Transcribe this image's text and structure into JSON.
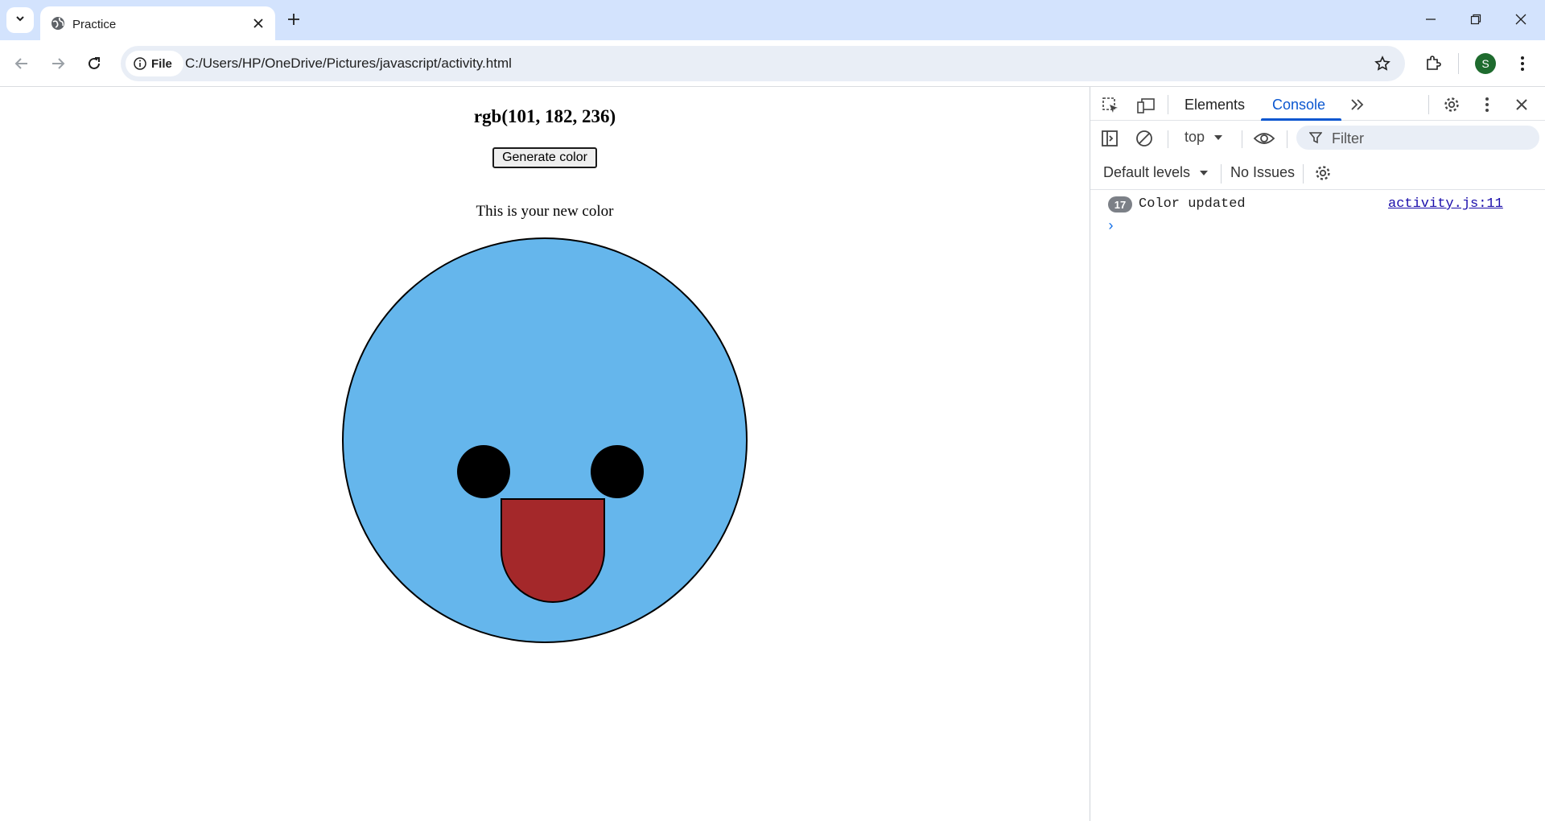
{
  "browser": {
    "tab": {
      "title": "Practice"
    },
    "address": {
      "chip_label": "File",
      "url": "C:/Users/HP/OneDrive/Pictures/javascript/activity.html"
    },
    "profile_initial": "S"
  },
  "page": {
    "rgb_heading": "rgb(101, 182, 236)",
    "generate_button": "Generate color",
    "new_color_text": "This is your new color",
    "face_color": "#65b6ec",
    "tongue_color": "#a4282a"
  },
  "devtools": {
    "tabs": [
      "Elements",
      "Console"
    ],
    "active_tab": "Console",
    "context": "top",
    "filter_placeholder": "Filter",
    "levels": "Default levels",
    "issues": "No Issues",
    "log": {
      "count": "17",
      "message": "Color updated",
      "source": "activity.js:11"
    },
    "prompt": "›"
  },
  "colors": {
    "accent": "#0b57d0",
    "tabstrip": "#d3e3fd"
  }
}
